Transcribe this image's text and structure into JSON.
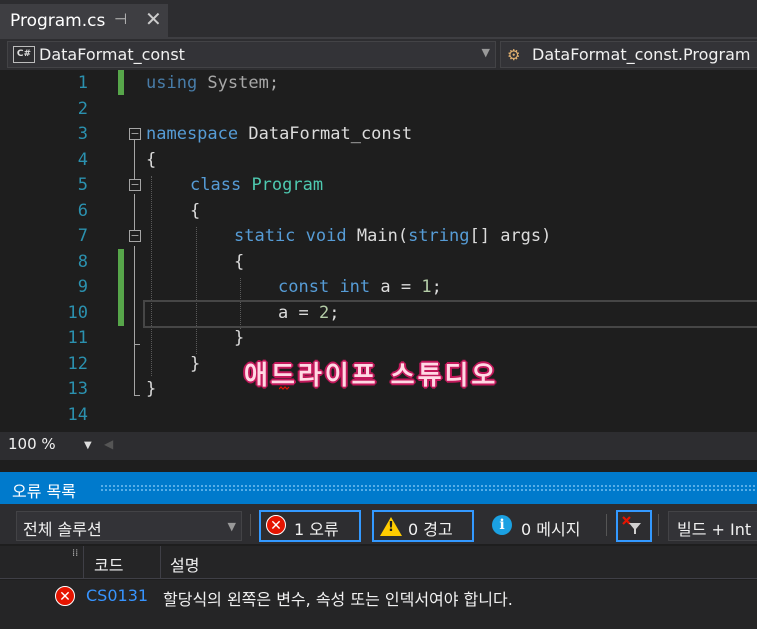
{
  "tab": {
    "title": "Program.cs",
    "pin_glyph": "⊣",
    "close_glyph": "✕"
  },
  "nav": {
    "project": "DataFormat_const",
    "cs_badge": "C#",
    "class": "DataFormat_const.Program"
  },
  "editor": {
    "line_numbers": [
      "1",
      "2",
      "3",
      "4",
      "5",
      "6",
      "7",
      "8",
      "9",
      "10",
      "11",
      "12",
      "13",
      "14"
    ],
    "lines": {
      "l1_kw": "using",
      "l1_rest": " System;",
      "l3_kw": "namespace",
      "l3_rest": " DataFormat_const",
      "l4": "{",
      "l5_kw": "class",
      "l5_ty": "Program",
      "l6": "{",
      "l7_kw1": "static",
      "l7_kw2": "void",
      "l7_name": "Main(",
      "l7_kw3": "string",
      "l7_rest": "[] args)",
      "l8": "{",
      "l9_kw1": "const",
      "l9_kw2": "int",
      "l9_mid": " a = ",
      "l9_num": "1",
      "l9_end": ";",
      "l10_a": "a",
      "l10_mid": " = ",
      "l10_num": "2",
      "l10_end": ";",
      "l11": "}",
      "l12": "}",
      "l13": "}"
    },
    "watermark": "애드라이프 스튜디오",
    "colors": {
      "keyword": "#569cd6",
      "type": "#4ec9b0",
      "number": "#b5cea8",
      "line_number": "#2b91af",
      "change_bar": "#57a64a"
    }
  },
  "zoom": {
    "level": "100 %"
  },
  "error_list": {
    "title": "오류 목록",
    "scope": "전체 솔루션",
    "errors_label": "1 오류",
    "warnings_label": "0 경고",
    "messages_label": "0 메시지",
    "build_label": "빌드 + Int",
    "columns": {
      "code": "코드",
      "description": "설명"
    },
    "rows": [
      {
        "code": "CS0131",
        "description": "할당식의 왼쪽은 변수, 속성 또는 인덱서여야 합니다."
      }
    ]
  }
}
